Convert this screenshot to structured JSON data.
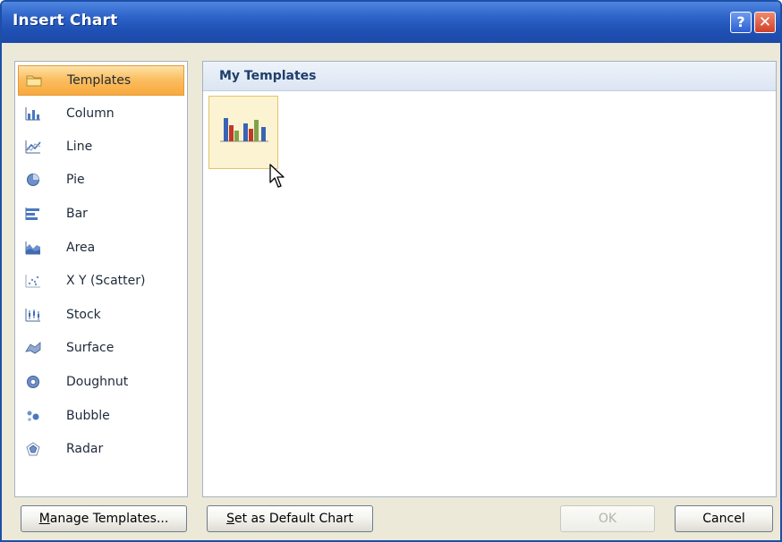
{
  "window": {
    "title": "Insert Chart",
    "help_label": "?",
    "close_label": "✕"
  },
  "sidebar": {
    "items": [
      {
        "label": "Templates",
        "icon": "folder-icon",
        "selected": true
      },
      {
        "label": "Column",
        "icon": "column-chart-icon"
      },
      {
        "label": "Line",
        "icon": "line-chart-icon"
      },
      {
        "label": "Pie",
        "icon": "pie-chart-icon"
      },
      {
        "label": "Bar",
        "icon": "bar-chart-icon"
      },
      {
        "label": "Area",
        "icon": "area-chart-icon"
      },
      {
        "label": "X Y (Scatter)",
        "icon": "scatter-chart-icon"
      },
      {
        "label": "Stock",
        "icon": "stock-chart-icon"
      },
      {
        "label": "Surface",
        "icon": "surface-chart-icon"
      },
      {
        "label": "Doughnut",
        "icon": "doughnut-chart-icon"
      },
      {
        "label": "Bubble",
        "icon": "bubble-chart-icon"
      },
      {
        "label": "Radar",
        "icon": "radar-chart-icon"
      }
    ]
  },
  "main": {
    "section_title": "My Templates",
    "templates": [
      {
        "icon": "column-chart-template-icon"
      }
    ]
  },
  "footer": {
    "manage_templates": {
      "accel": "M",
      "rest": "anage Templates..."
    },
    "set_default": {
      "accel": "S",
      "rest": "et as Default Chart"
    },
    "ok_label": "OK",
    "cancel_label": "Cancel"
  },
  "colors": {
    "title_bar": "#2a5ec4",
    "selected_item": "#fbbf62",
    "template_border": "#e2c46e"
  }
}
